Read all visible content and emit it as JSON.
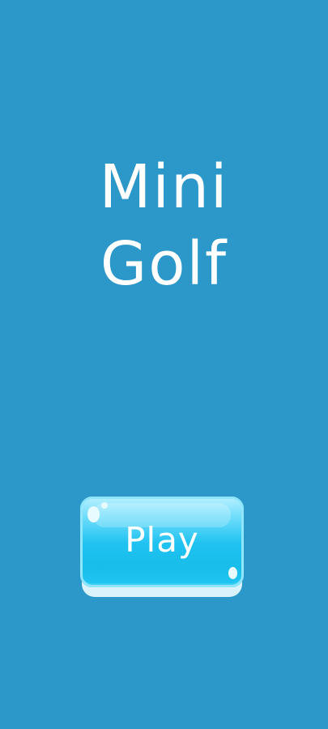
{
  "screen": {
    "background_color": "#2b98c9"
  },
  "title": {
    "line1": "Mini",
    "line2": "Golf",
    "color": "#ffffff"
  },
  "play_button": {
    "label": "Play",
    "color": "#1fc2f1",
    "text_color": "#ffffff"
  }
}
